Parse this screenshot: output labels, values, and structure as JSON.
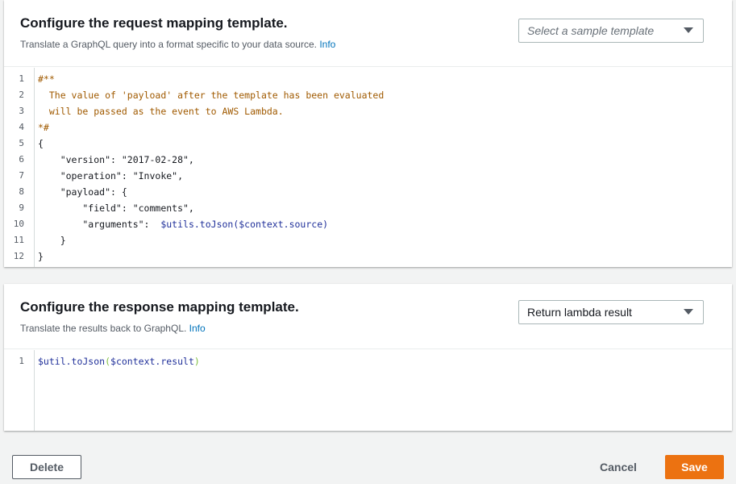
{
  "request": {
    "title": "Configure the request mapping template.",
    "description": "Translate a GraphQL query into a format specific to your data source.",
    "info_link": "Info",
    "select_placeholder": "Select a sample template",
    "lines": [
      {
        "n": "1",
        "parts": [
          {
            "t": "#**",
            "c": "comment"
          }
        ]
      },
      {
        "n": "2",
        "parts": [
          {
            "t": "  The value of 'payload' after the template has been evaluated",
            "c": "comment"
          }
        ]
      },
      {
        "n": "3",
        "parts": [
          {
            "t": "  will be passed as the event to AWS Lambda.",
            "c": "comment"
          }
        ]
      },
      {
        "n": "4",
        "parts": [
          {
            "t": "*#",
            "c": "comment"
          }
        ]
      },
      {
        "n": "5",
        "parts": [
          {
            "t": "{",
            "c": ""
          }
        ]
      },
      {
        "n": "6",
        "parts": [
          {
            "t": "    \"version\": \"2017-02-28\",",
            "c": ""
          }
        ]
      },
      {
        "n": "7",
        "parts": [
          {
            "t": "    \"operation\": \"Invoke\",",
            "c": ""
          }
        ]
      },
      {
        "n": "8",
        "parts": [
          {
            "t": "    \"payload\": {",
            "c": ""
          }
        ]
      },
      {
        "n": "9",
        "parts": [
          {
            "t": "        \"field\": \"comments\",",
            "c": ""
          }
        ]
      },
      {
        "n": "10",
        "parts": [
          {
            "t": "        \"arguments\":  ",
            "c": ""
          },
          {
            "t": "$utils.toJson($context.source)",
            "c": "var"
          }
        ]
      },
      {
        "n": "11",
        "parts": [
          {
            "t": "    }",
            "c": ""
          }
        ]
      },
      {
        "n": "12",
        "parts": [
          {
            "t": "}",
            "c": ""
          }
        ]
      }
    ]
  },
  "response": {
    "title": "Configure the response mapping template.",
    "description": "Translate the results back to GraphQL.",
    "info_link": "Info",
    "select_value": "Return lambda result",
    "lines": [
      {
        "n": "1",
        "parts": [
          {
            "t": "$util.toJson",
            "c": "var"
          },
          {
            "t": "(",
            "c": "paren"
          },
          {
            "t": "$context.result",
            "c": "var"
          },
          {
            "t": ")",
            "c": "paren"
          }
        ]
      }
    ]
  },
  "footer": {
    "delete_label": "Delete",
    "cancel_label": "Cancel",
    "save_label": "Save"
  },
  "colors": {
    "accent": "#ec7211",
    "link": "#0073bb",
    "comment": "#a05a00",
    "variable": "#20309a"
  },
  "icons": {
    "dropdown": "caret-down-icon"
  }
}
